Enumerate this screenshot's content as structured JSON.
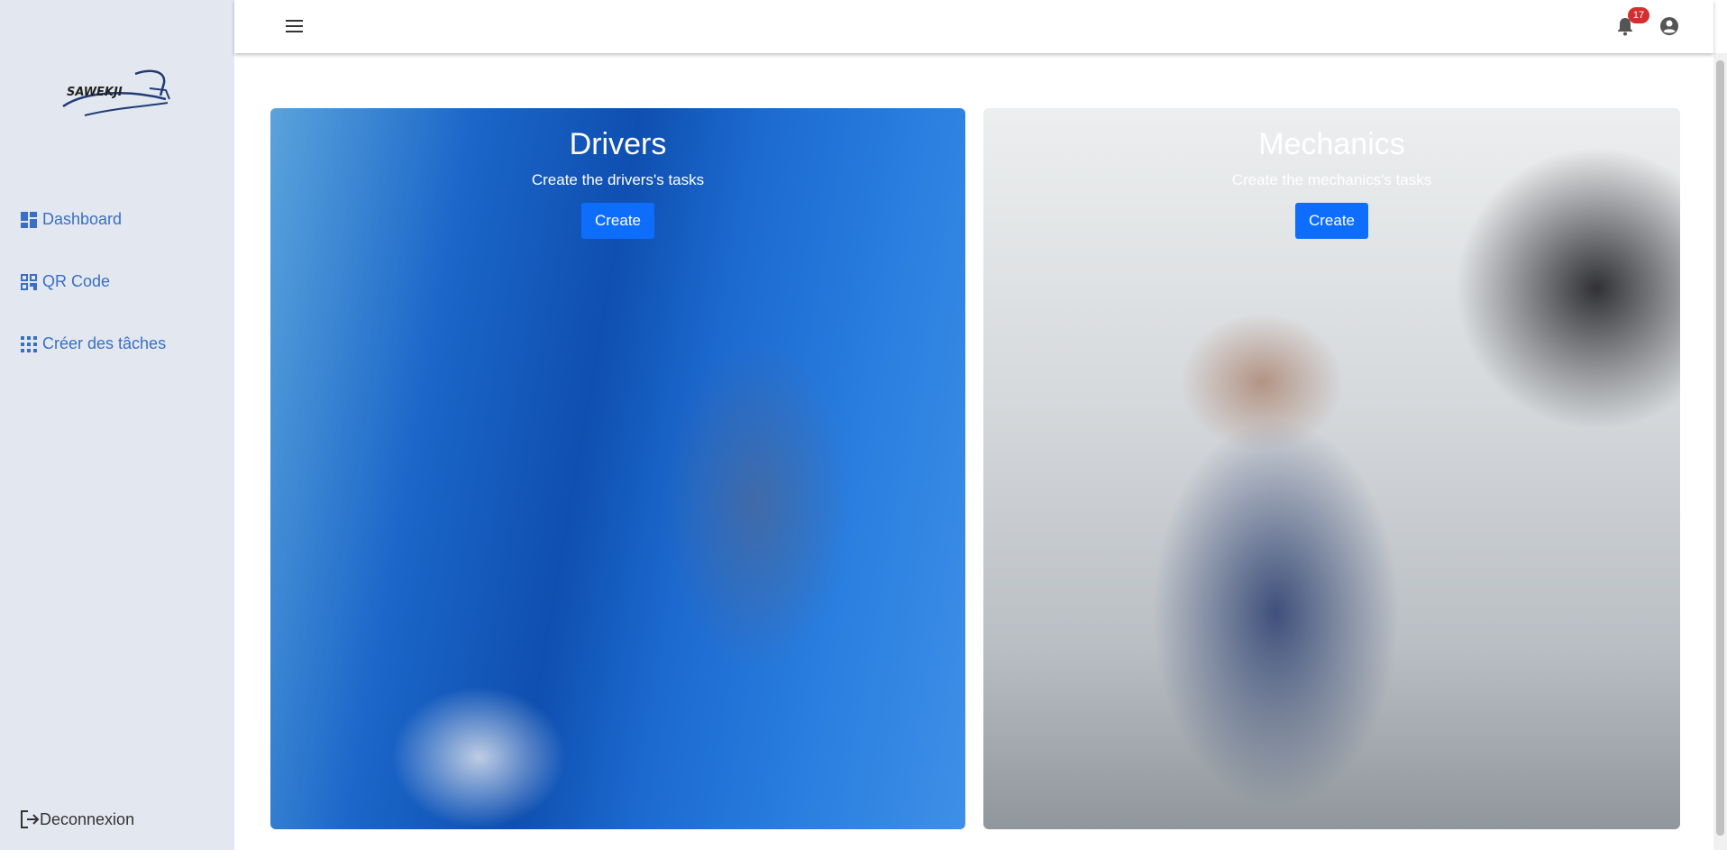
{
  "app": {
    "logo_text": "SAWEKJI"
  },
  "sidebar": {
    "items": [
      {
        "label": "Dashboard",
        "icon": "dashboard-icon"
      },
      {
        "label": "QR Code",
        "icon": "qr-code-icon"
      },
      {
        "label": "Créer des tâches",
        "icon": "apps-grid-icon"
      }
    ],
    "logout_label": "Deconnexion"
  },
  "topbar": {
    "notification_count": "17",
    "icons": [
      "menu-icon",
      "bell-icon",
      "account-circle-icon"
    ]
  },
  "cards": [
    {
      "title": "Drivers",
      "subtitle": "Create the drivers's tasks",
      "button": "Create"
    },
    {
      "title": "Mechanics",
      "subtitle": "Create the mechanics's tasks",
      "button": "Create"
    }
  ],
  "colors": {
    "sidebar_bg": "#e3e8f0",
    "nav_link": "#3a6fc4",
    "primary_button": "#0d6efd",
    "badge": "#d32f2f"
  }
}
